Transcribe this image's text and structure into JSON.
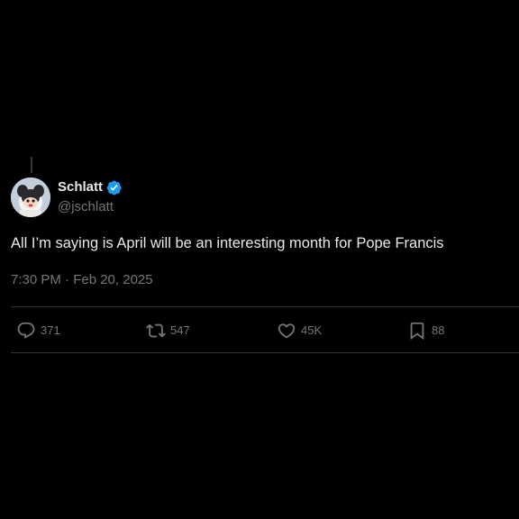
{
  "tweet": {
    "display_name": "Schlatt",
    "handle": "@jschlatt",
    "verified": true,
    "text": "All I’m saying is April will be an interesting month for Pope Francis",
    "timestamp": "7:30 PM · Feb 20, 2025"
  },
  "actions": {
    "reply": {
      "icon": "reply-icon",
      "count": "371"
    },
    "retweet": {
      "icon": "retweet-icon",
      "count": "547"
    },
    "like": {
      "icon": "heart-icon",
      "count": "45K"
    },
    "bookmark": {
      "icon": "bookmark-icon",
      "count": "88"
    }
  },
  "colors": {
    "background": "#000000",
    "primary_text": "#e7e9ea",
    "secondary_text": "#71767b",
    "divider": "#2f3336",
    "verified_badge": "#1d9bf0"
  }
}
